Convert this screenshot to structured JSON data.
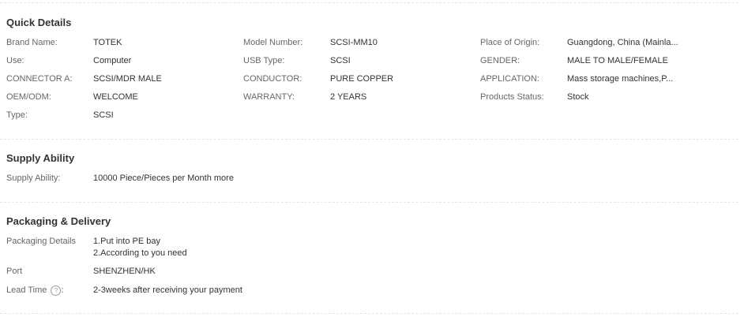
{
  "quick_details": {
    "title": "Quick Details",
    "rows": [
      [
        {
          "label": "Brand Name:",
          "value": "TOTEK"
        },
        {
          "label": "Model Number:",
          "value": "SCSI-MM10"
        },
        {
          "label": "Place of Origin:",
          "value": "Guangdong, China (Mainla..."
        }
      ],
      [
        {
          "label": "Use:",
          "value": "Computer"
        },
        {
          "label": "USB Type:",
          "value": "SCSI"
        },
        {
          "label": "GENDER:",
          "value": "MALE TO MALE/FEMALE"
        }
      ],
      [
        {
          "label": "CONNECTOR A:",
          "value": "SCSI/MDR MALE"
        },
        {
          "label": "CONDUCTOR:",
          "value": "PURE COPPER"
        },
        {
          "label": "APPLICATION:",
          "value": "Mass storage machines,P..."
        }
      ],
      [
        {
          "label": "OEM/ODM:",
          "value": "WELCOME"
        },
        {
          "label": "WARRANTY:",
          "value": "2 YEARS"
        },
        {
          "label": "Products Status:",
          "value": "Stock"
        }
      ],
      [
        {
          "label": "Type:",
          "value": "SCSI"
        }
      ]
    ]
  },
  "supply_ability": {
    "title": "Supply Ability",
    "label": "Supply Ability:",
    "value": "10000 Piece/Pieces per Month more"
  },
  "packaging_delivery": {
    "title": "Packaging & Delivery",
    "packaging_label": "Packaging Details",
    "packaging_line1": "1.Put into PE bay",
    "packaging_line2": "2.According to you need",
    "port_label": "Port",
    "port_value": "SHENZHEN/HK",
    "lead_time_label": "Lead Time",
    "lead_time_help": "?",
    "lead_time_colon": ":",
    "lead_time_value": "2-3weeks after receiving your payment"
  }
}
